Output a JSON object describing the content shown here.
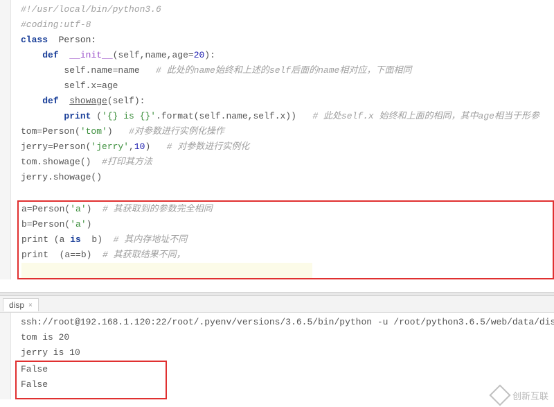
{
  "code": {
    "line1": "#!/usr/local/bin/python3.6",
    "line2": "#coding:utf-8",
    "kwClass": "class",
    "clsName": "Person:",
    "kwDef": "def",
    "init": "__init__",
    "initArgs": "(self,name,age=",
    "initDefault": "20",
    "initClose": "):",
    "selfName": "self.name=name",
    "cmt1": "# 此处的",
    "cmt1_i1": "name",
    "cmt1_mid": "始终和上述的",
    "cmt1_i2": "self",
    "cmt1_mid2": "后面的",
    "cmt1_i3": "name",
    "cmt1_end": "相对应，下面相同",
    "selfX": "self.x=age",
    "fnShow": "showage",
    "fnShowArgs": "(self):",
    "printKw": "print",
    "printOpen": " (",
    "fmtStr": "'{} is {}'",
    "fmtCall": ".format(self.name,self.x))   ",
    "cmt2": "# 此处",
    "cmt2_i1": "self.x ",
    "cmt2_mid": "始终和上面的相同，其中",
    "cmt2_i2": "age",
    "cmt2_end": "相当于形参",
    "tomAssign": "tom=Person(",
    "tomStr": "'tom'",
    "tomClose": ")   ",
    "tomCmt": "#对参数进行实例化操作",
    "jerAssign": "jerry=Person(",
    "jerStr": "'jerry'",
    "jerComma": ",",
    "jerNum": "10",
    "jerClose": ")   ",
    "jerCmt": "# 对参数进行实例化",
    "tomShow": "tom.showage()  ",
    "tomShowCmt": "#打印其方法",
    "jerShow": "jerry.showage()",
    "aAssign": "a=Person(",
    "aStr": "'a'",
    "aClose": ")  ",
    "aCmt": "# 其获取到的参数完全相同",
    "bAssign": "b=Person(",
    "bStr": "'a'",
    "bClose": ")",
    "pIs1": "print (a ",
    "isKw": "is",
    "pIs2": "  b)  ",
    "pIsCmt": "# 其内存地址不同",
    "pEq": "print  (a==b)  ",
    "pEqCmt": "# 其获取结果不同，"
  },
  "tab": {
    "label": "disp",
    "closeGlyph": "×"
  },
  "terminal": {
    "cmd": "ssh://root@192.168.1.120:22/root/.pyenv/versions/3.6.5/bin/python -u /root/python3.6.5/web/data/dis",
    "out1": "tom is 20",
    "out2": "jerry is 10",
    "out3": "False",
    "out4": "False"
  },
  "watermark": "创新互联"
}
